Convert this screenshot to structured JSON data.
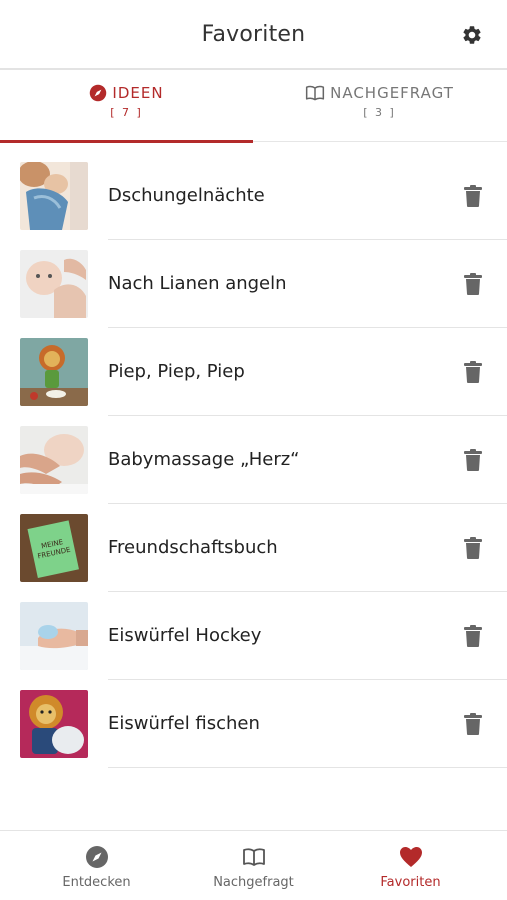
{
  "header": {
    "title": "Favoriten",
    "settings_icon": "gear-icon"
  },
  "tabs": [
    {
      "label": "IDEEN",
      "count": "[ 7 ]",
      "icon": "compass-icon",
      "active": true
    },
    {
      "label": "NACHGEFRAGT",
      "count": "[ 3 ]",
      "icon": "book-icon",
      "active": false
    }
  ],
  "favorites": [
    {
      "title": "Dschungelnächte"
    },
    {
      "title": "Nach Lianen angeln"
    },
    {
      "title": "Piep, Piep, Piep"
    },
    {
      "title": "Babymassage „Herz“"
    },
    {
      "title": "Freundschaftsbuch",
      "thumb_text": [
        "MEINE",
        "FREUNDE"
      ]
    },
    {
      "title": "Eiswürfel Hockey"
    },
    {
      "title": "Eiswürfel fischen"
    }
  ],
  "bottom_nav": [
    {
      "label": "Entdecken",
      "icon": "compass-icon",
      "active": false
    },
    {
      "label": "Nachgefragt",
      "icon": "book-icon",
      "active": false
    },
    {
      "label": "Favoriten",
      "icon": "heart-icon",
      "active": true
    }
  ],
  "colors": {
    "accent": "#b32a2a",
    "icon_gray": "#666666",
    "divider": "#e4e4e4"
  }
}
